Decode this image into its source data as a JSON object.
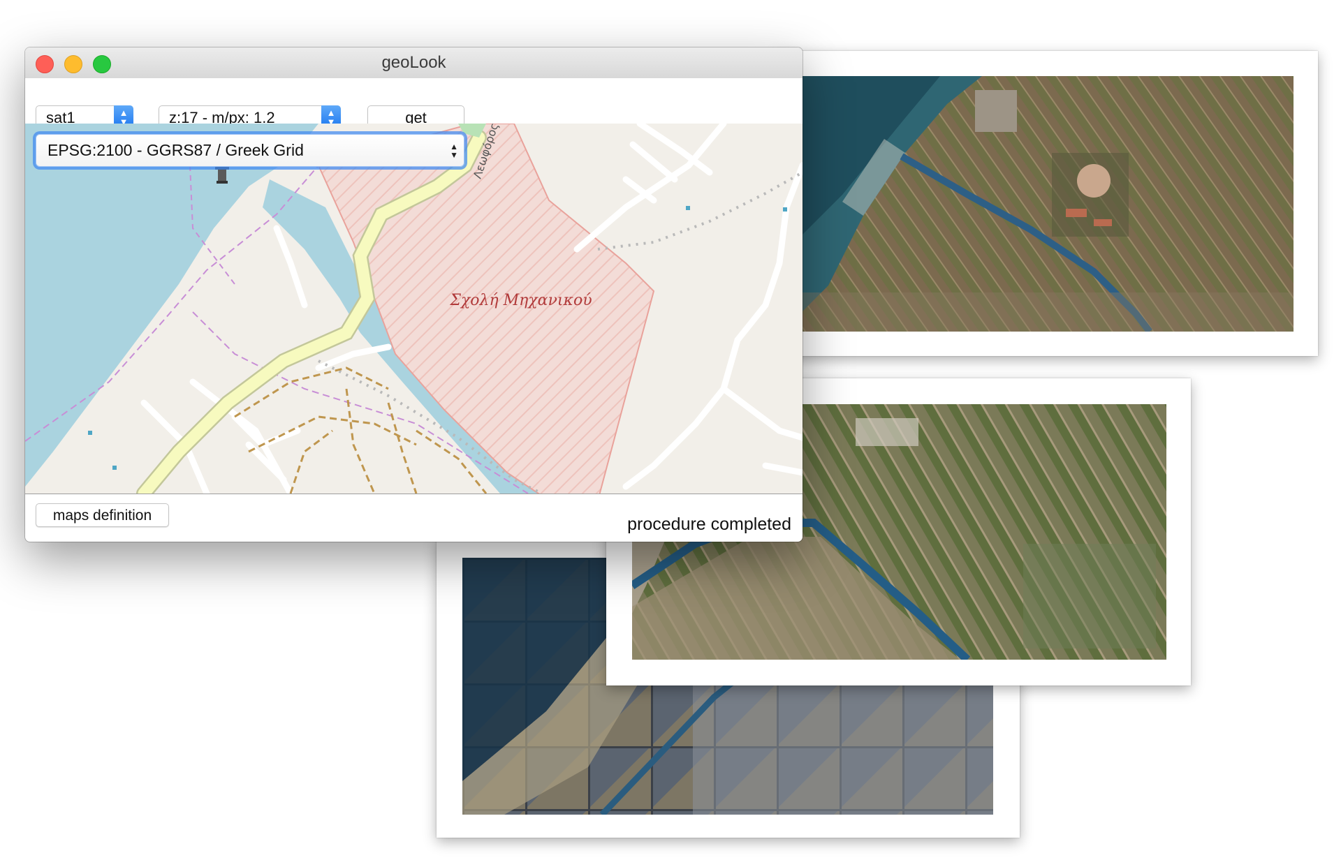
{
  "window": {
    "title": "geoLook"
  },
  "toolbar": {
    "source_value": "sat1",
    "zoom_value": "z:17 - m/px: 1.2",
    "get_label": "get"
  },
  "map": {
    "crs_value": "EPSG:2100 - GGRS87 / Greek Grid",
    "area_label": "Σχολή Μηχανικού",
    "road_label": "Λεωφόρος"
  },
  "footer": {
    "maps_definition_label": "maps definition",
    "status": "procedure completed"
  },
  "icons": {
    "lighthouse": "lighthouse-icon",
    "popup_arrows": "updown-arrows-icon"
  },
  "colors": {
    "sea": "#aad3df",
    "land": "#f2efe9",
    "zone": "#f3dcd7",
    "primary_road": "#f7fabf",
    "boundary": "#c88ed6",
    "accent_blue": "#1a76f0"
  }
}
